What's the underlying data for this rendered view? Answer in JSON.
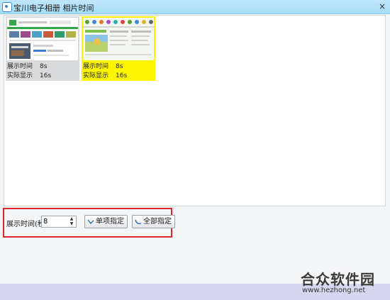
{
  "window": {
    "title": "宝川电子相册  相片时间",
    "close_label": "×"
  },
  "gallery": {
    "items": [
      {
        "display_label": "展示时间",
        "display_value": "8s",
        "actual_label": "实际显示",
        "actual_value": "16s",
        "selected": false
      },
      {
        "display_label": "展示时间",
        "display_value": "8s",
        "actual_label": "实际显示",
        "actual_value": "16s",
        "selected": true
      }
    ],
    "selected_color": "#fdf500"
  },
  "controls": {
    "duration_label": "展示时间(秒)",
    "duration_value": "8",
    "single_button_label": "单项指定",
    "all_button_label": "全部指定",
    "highlight_color": "#e0262b"
  },
  "watermark": {
    "brand": "合众软件园",
    "url": "www.hezhong.net"
  }
}
